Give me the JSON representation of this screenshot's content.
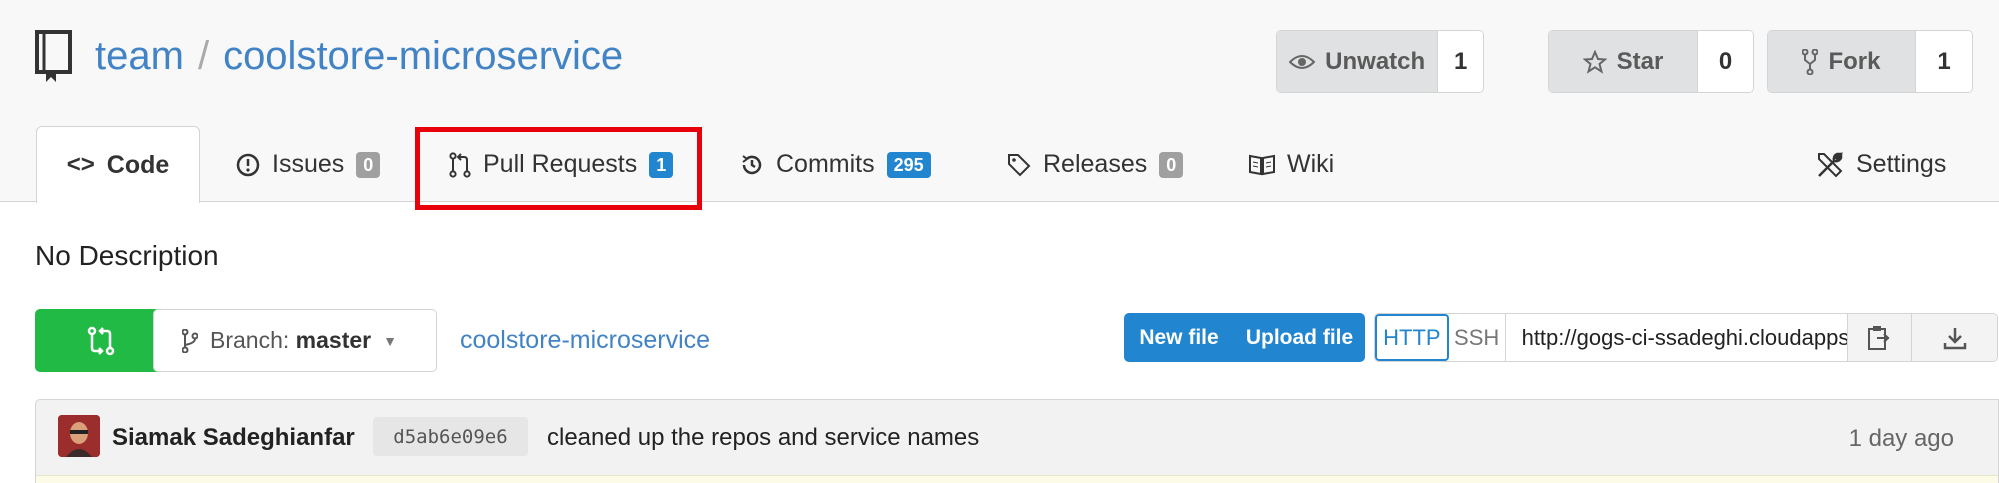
{
  "header": {
    "owner": "team",
    "separator": "/",
    "repo": "coolstore-microservice",
    "watch": {
      "label": "Unwatch",
      "count": "1"
    },
    "star": {
      "label": "Star",
      "count": "0"
    },
    "fork": {
      "label": "Fork",
      "count": "1"
    }
  },
  "tabs": [
    {
      "label": "Code",
      "icon": "code-icon"
    },
    {
      "label": "Issues",
      "badge": "0",
      "icon": "issue-icon"
    },
    {
      "label": "Pull Requests",
      "badge": "1",
      "icon": "pull-request-icon"
    },
    {
      "label": "Commits",
      "badge": "295",
      "icon": "history-icon"
    },
    {
      "label": "Releases",
      "badge": "0",
      "icon": "tag-icon"
    },
    {
      "label": "Wiki",
      "icon": "book-icon"
    },
    {
      "label": "Settings",
      "icon": "tools-icon"
    }
  ],
  "description": "No Description",
  "toolbar": {
    "branch_prefix": "Branch:",
    "branch_name": "master",
    "repo_link": "coolstore-microservice",
    "new_file": "New file",
    "upload_file": "Upload file",
    "http": "HTTP",
    "ssh": "SSH",
    "clone_url": "http://gogs-ci-ssadeghi.cloudapps"
  },
  "commit": {
    "author": "Siamak Sadeghianfar",
    "sha": "d5ab6e09e6",
    "message": "cleaned up the repos and service names",
    "time": "1 day ago"
  },
  "colors": {
    "link": "#4183c4",
    "primary": "#2185d0",
    "green": "#21ba45",
    "highlight": "#e8000b"
  }
}
